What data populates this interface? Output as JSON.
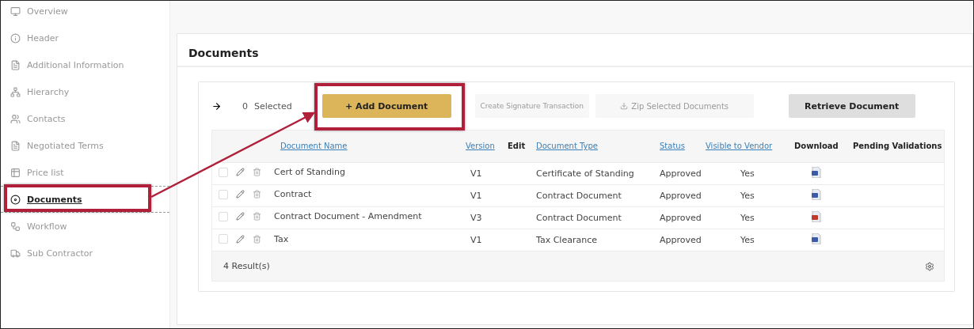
{
  "sidebar": {
    "items": [
      {
        "label": "Overview",
        "kind": "monitor",
        "selected": false
      },
      {
        "label": "Header",
        "kind": "info",
        "selected": false
      },
      {
        "label": "Additional Information",
        "kind": "file",
        "selected": false
      },
      {
        "label": "Hierarchy",
        "kind": "hierarchy",
        "selected": false
      },
      {
        "label": "Contacts",
        "kind": "people",
        "selected": false
      },
      {
        "label": "Negotiated Terms",
        "kind": "file",
        "selected": false
      },
      {
        "label": "Price list",
        "kind": "table",
        "selected": false
      },
      {
        "label": "Documents",
        "kind": "disc",
        "selected": true
      },
      {
        "label": "Workflow",
        "kind": "workflow",
        "selected": false
      },
      {
        "label": "Sub Contractor",
        "kind": "truck",
        "selected": false
      }
    ]
  },
  "section": {
    "title": "Documents"
  },
  "toolbar": {
    "selected_count": "0",
    "selected_label": "Selected",
    "buttons": [
      {
        "label": "+ Add Document",
        "kind": "primary",
        "disabled": false
      },
      {
        "label": "Create Signature Transaction",
        "kind": "plain",
        "disabled": true
      },
      {
        "label": "Zip Selected Documents",
        "kind": "zip",
        "disabled": true
      },
      {
        "label": "Retrieve Document",
        "kind": "secondary",
        "disabled": false
      }
    ]
  },
  "table": {
    "columns": [
      {
        "label": "Document Name",
        "sortable": true
      },
      {
        "label": "Version",
        "sortable": true
      },
      {
        "label": "Edit",
        "sortable": false
      },
      {
        "label": "Document Type",
        "sortable": true
      },
      {
        "label": "Status",
        "sortable": true
      },
      {
        "label": "Visible to Vendor",
        "sortable": true
      },
      {
        "label": "Download",
        "sortable": false
      },
      {
        "label": "Pending Validations",
        "sortable": false
      }
    ],
    "rows": [
      {
        "checked": false,
        "name": "Cert of Standing",
        "version": "V1",
        "type": "Certificate of Standing",
        "status": "Approved",
        "visible": "Yes",
        "kind": "word"
      },
      {
        "checked": false,
        "name": "Contract",
        "version": "V1",
        "type": "Contract Document",
        "status": "Approved",
        "visible": "Yes",
        "kind": "word"
      },
      {
        "checked": false,
        "name": "Contract Document - Amendment",
        "version": "V3",
        "type": "Contract Document",
        "status": "Approved",
        "visible": "Yes",
        "kind": "pdf"
      },
      {
        "checked": false,
        "name": "Tax",
        "version": "V1",
        "type": "Tax Clearance",
        "status": "Approved",
        "visible": "Yes",
        "kind": "word"
      }
    ],
    "footer": "4 Result(s)"
  }
}
